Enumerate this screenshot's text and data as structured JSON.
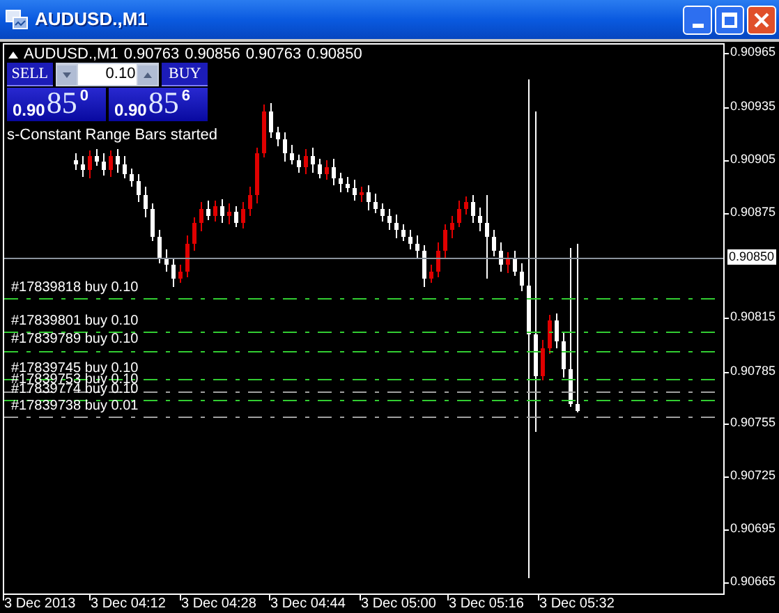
{
  "window": {
    "title": "AUDUSD.,M1"
  },
  "chart_header": {
    "symbol": "AUDUSD.,M1",
    "values": [
      "0.90763",
      "0.90856",
      "0.90763",
      "0.90850"
    ]
  },
  "trade_panel": {
    "sell_label": "SELL",
    "buy_label": "BUY",
    "lot": "0.10",
    "sell_price": {
      "prefix": "0.90",
      "big": "85",
      "sup": "0"
    },
    "buy_price": {
      "prefix": "0.90",
      "big": "85",
      "sup": "6"
    }
  },
  "message": "s-Constant Range Bars started",
  "orders": [
    {
      "label": "#17839818 buy 0.10"
    },
    {
      "label": "#17839801 buy 0.10"
    },
    {
      "label": "#17839789 buy 0.10"
    },
    {
      "label": "#17839745 buy 0.10"
    },
    {
      "label": "#17839753 buy 0.10"
    },
    {
      "label": "#17839774 buy 0.10"
    },
    {
      "label": "#17839738 buy 0.01"
    }
  ],
  "price_axis": [
    "0.90965",
    "0.90935",
    "0.90905",
    "0.90875",
    "0.90815",
    "0.90785",
    "0.90755",
    "0.90725",
    "0.90695",
    "0.90665"
  ],
  "current_price": "0.90850",
  "time_axis": [
    "3 Dec 2013",
    "3 Dec 04:12",
    "3 Dec 04:28",
    "3 Dec 04:44",
    "3 Dec 05:00",
    "3 Dec 05:16",
    "3 Dec 05:32"
  ]
}
